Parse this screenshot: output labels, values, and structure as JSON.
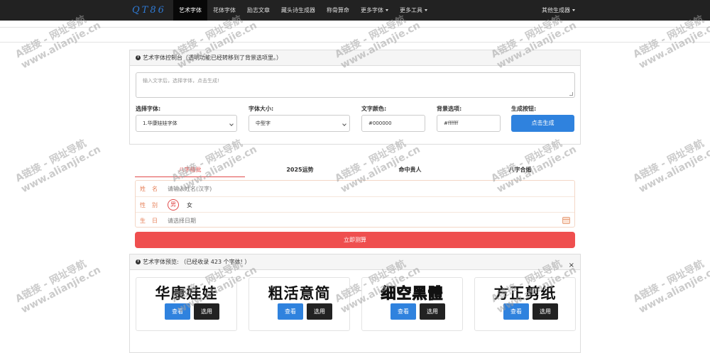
{
  "nav": {
    "brand": "QT86",
    "items": [
      {
        "label": "艺术字体",
        "active": true
      },
      {
        "label": "花体字体"
      },
      {
        "label": "励志文章"
      },
      {
        "label": "藏头诗生成器"
      },
      {
        "label": "称骨算命"
      },
      {
        "label": "更多字体",
        "dropdown": true
      },
      {
        "label": "更多工具",
        "dropdown": true
      }
    ],
    "right": "其他生成器"
  },
  "control": {
    "header": "艺术字体控制台（透明功能已经转移到了背景选项里。）",
    "text_placeholder": "输入文字后，选择字体，点击生成!",
    "font_label": "选择字体:",
    "font_value": "1.华康娃娃字体",
    "size_label": "字体大小:",
    "size_value": "中型字",
    "color_label": "文字颜色:",
    "color_value": "#000000",
    "bg_label": "背景选项:",
    "bg_value": "#ffffff",
    "gen_label": "生成按钮:",
    "gen_button": "点击生成"
  },
  "bazi": {
    "tabs": [
      "八字精批",
      "2025运势",
      "命中贵人",
      "八字合婚"
    ],
    "name_label": "姓名",
    "name_placeholder": "请输入姓名(汉字)",
    "gender_label": "性别",
    "male": "男",
    "female": "女",
    "birth_label": "生日",
    "birth_placeholder": "请选择日期",
    "submit": "立即测算"
  },
  "preview": {
    "header": "艺术字体预览: （已经收录 423 个字体! ）",
    "close": "×",
    "view_label": "查看",
    "use_label": "选用",
    "cards": [
      {
        "sample": "华康娃娃"
      },
      {
        "sample": "粗活意简"
      },
      {
        "sample": "细空黑體"
      },
      {
        "sample": "方正剪纸"
      }
    ]
  },
  "watermark": {
    "line1": "A链接 - 网址导航",
    "line2": "www.alianjie.cn"
  },
  "colors": {
    "nav_bg": "#222222",
    "brand": "#2f7bd6",
    "primary": "#2f82de",
    "danger": "#ef4f4f",
    "accent_orange": "#e67e56"
  }
}
